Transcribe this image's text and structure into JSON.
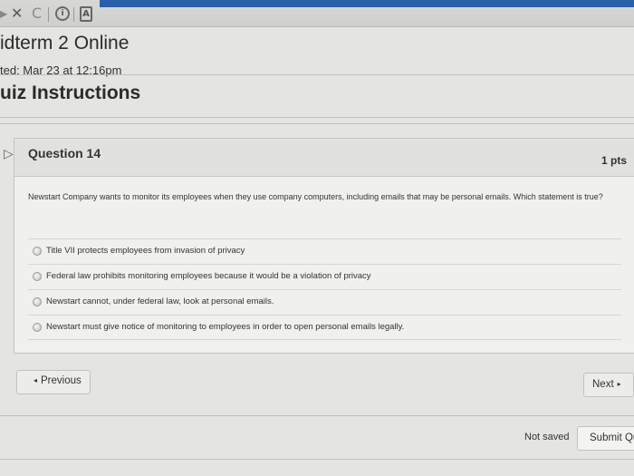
{
  "toolbar": {
    "icons": [
      "back-arrow-icon",
      "close-icon",
      "refresh-icon",
      "info-icon",
      "document-icon"
    ],
    "close_glyph": "✕",
    "refresh_glyph": "C",
    "info_glyph": "i",
    "doc_glyph": "A"
  },
  "header": {
    "title": "idterm 2 Online",
    "started": "ted: Mar 23 at 12:16pm",
    "instructions": "uiz Instructions"
  },
  "question": {
    "title": "Question 14",
    "points": "1 pts",
    "text": "Newstart Company wants to monitor its employees when they use company computers, including emails that may be personal emails. Which statement is true?",
    "answers": [
      "Title VII protects employees from invasion of privacy",
      "Federal law prohibits monitoring employees because it would be a violation of privacy",
      "Newstart cannot, under federal law, look at personal emails.",
      "Newstart must give notice of monitoring to employees in order to open personal emails legally."
    ]
  },
  "nav": {
    "previous_label": "Previous",
    "next_label": "Next",
    "prev_caret": "◂",
    "next_caret": "▸"
  },
  "footer": {
    "status": "Not saved",
    "submit_label": "Submit Qu"
  }
}
